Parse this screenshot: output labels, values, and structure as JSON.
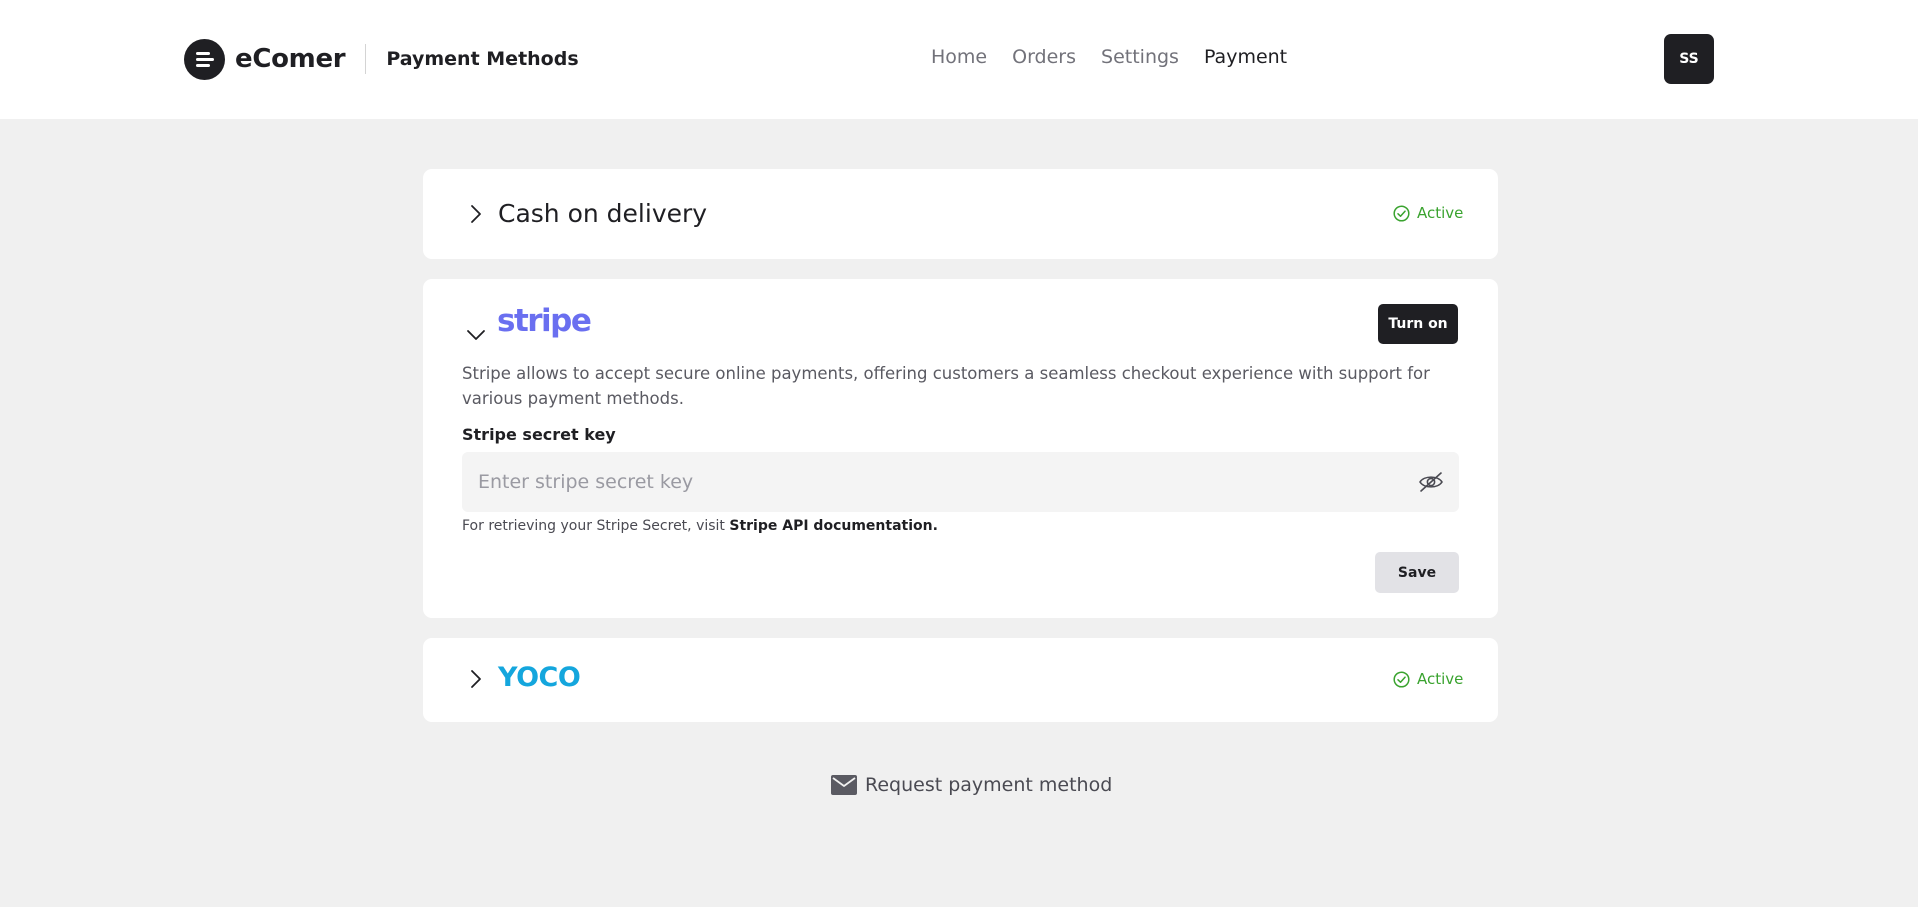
{
  "header": {
    "brand": "eComer",
    "page_title": "Payment Methods",
    "nav": [
      "Home",
      "Orders",
      "Settings",
      "Payment"
    ],
    "active_nav": "Payment",
    "avatar_initials": "SS"
  },
  "methods": {
    "cod": {
      "title": "Cash on delivery",
      "status": "Active",
      "expanded": false
    },
    "stripe": {
      "logo_text": "stripe",
      "expanded": true,
      "toggle_label": "Turn on",
      "description": "Stripe allows to accept secure online payments, offering customers a seamless checkout experience with support for various payment methods.",
      "secret_label": "Stripe secret key",
      "secret_placeholder": "Enter stripe secret key",
      "secret_value": "",
      "help_prefix": "For retrieving your Stripe Secret, visit ",
      "help_link": "Stripe API documentation.",
      "save_label": "Save"
    },
    "yoco": {
      "logo_text": "YOCO",
      "status": "Active",
      "expanded": false
    }
  },
  "request_label": "Request payment method",
  "colors": {
    "active_status": "#3aa32f",
    "stripe_brand": "#6a6ff0",
    "yoco_brand": "#14a6dd",
    "dark": "#1f1f23"
  }
}
